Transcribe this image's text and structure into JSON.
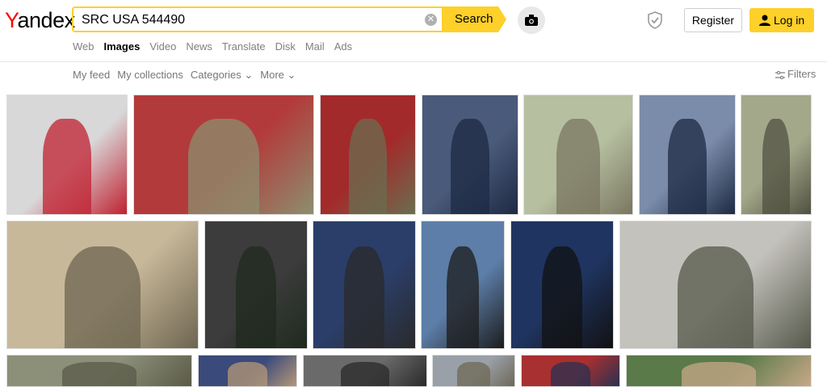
{
  "header": {
    "logo_first": "Y",
    "logo_rest": "andex",
    "search_value": "SRC USA 544490",
    "search_button": "Search",
    "register": "Register",
    "login": "Log in"
  },
  "nav": [
    "Web",
    "Images",
    "Video",
    "News",
    "Translate",
    "Disk",
    "Mail",
    "Ads"
  ],
  "nav_active": "Images",
  "subnav": [
    "My feed",
    "My collections",
    "Categories ⌄",
    "More ⌄"
  ],
  "filters_label": "Filters",
  "colors": {
    "accent": "#fdd02a",
    "logo_red": "#ff0000"
  },
  "images": [
    {
      "desc": "girl-red-dress",
      "bg": "#d8d8d8",
      "fg": "#c02030"
    },
    {
      "desc": "soldier-flag",
      "bg": "#b33a3a",
      "fg": "#8c8f6f"
    },
    {
      "desc": "general-portrait",
      "bg": "#a32a2a",
      "fg": "#6a6e50"
    },
    {
      "desc": "airforce-woman",
      "bg": "#4a5a7a",
      "fg": "#1e2a44"
    },
    {
      "desc": "soldier-rifle-forest",
      "bg": "#b6bfa0",
      "fg": "#7a7660"
    },
    {
      "desc": "airforce-general",
      "bg": "#7a8caa",
      "fg": "#1e2a44"
    },
    {
      "desc": "sniper-field",
      "bg": "#a3a88a",
      "fg": "#505040"
    },
    {
      "desc": "soldiers-combat",
      "bg": "#c8b89a",
      "fg": "#6e6550"
    },
    {
      "desc": "army-sergeant",
      "bg": "#3c3c3c",
      "fg": "#1f2a1f"
    },
    {
      "desc": "politician-portrait",
      "bg": "#2b3e6a",
      "fg": "#2a2a2a"
    },
    {
      "desc": "woman-portrait",
      "bg": "#5c7ea8",
      "fg": "#1c1c1c"
    },
    {
      "desc": "navy-admiral",
      "bg": "#1f3460",
      "fg": "#111"
    },
    {
      "desc": "soldiers-beach",
      "bg": "#c4c2bc",
      "fg": "#55584a"
    },
    {
      "desc": "soldiers-row",
      "bg": "#8d9078",
      "fg": "#5a5a48"
    },
    {
      "desc": "woman-flag",
      "bg": "#3a4a7a",
      "fg": "#b59878"
    },
    {
      "desc": "soldier-helmet",
      "bg": "#6a6a6a",
      "fg": "#2a2a2a"
    },
    {
      "desc": "soldiers-mountain",
      "bg": "#9aa0a8",
      "fg": "#6d6855"
    },
    {
      "desc": "soldier-flag-2",
      "bg": "#a83030",
      "fg": "#2a3050"
    },
    {
      "desc": "woman-outdoor",
      "bg": "#5a7a4a",
      "fg": "#c8a888"
    }
  ]
}
